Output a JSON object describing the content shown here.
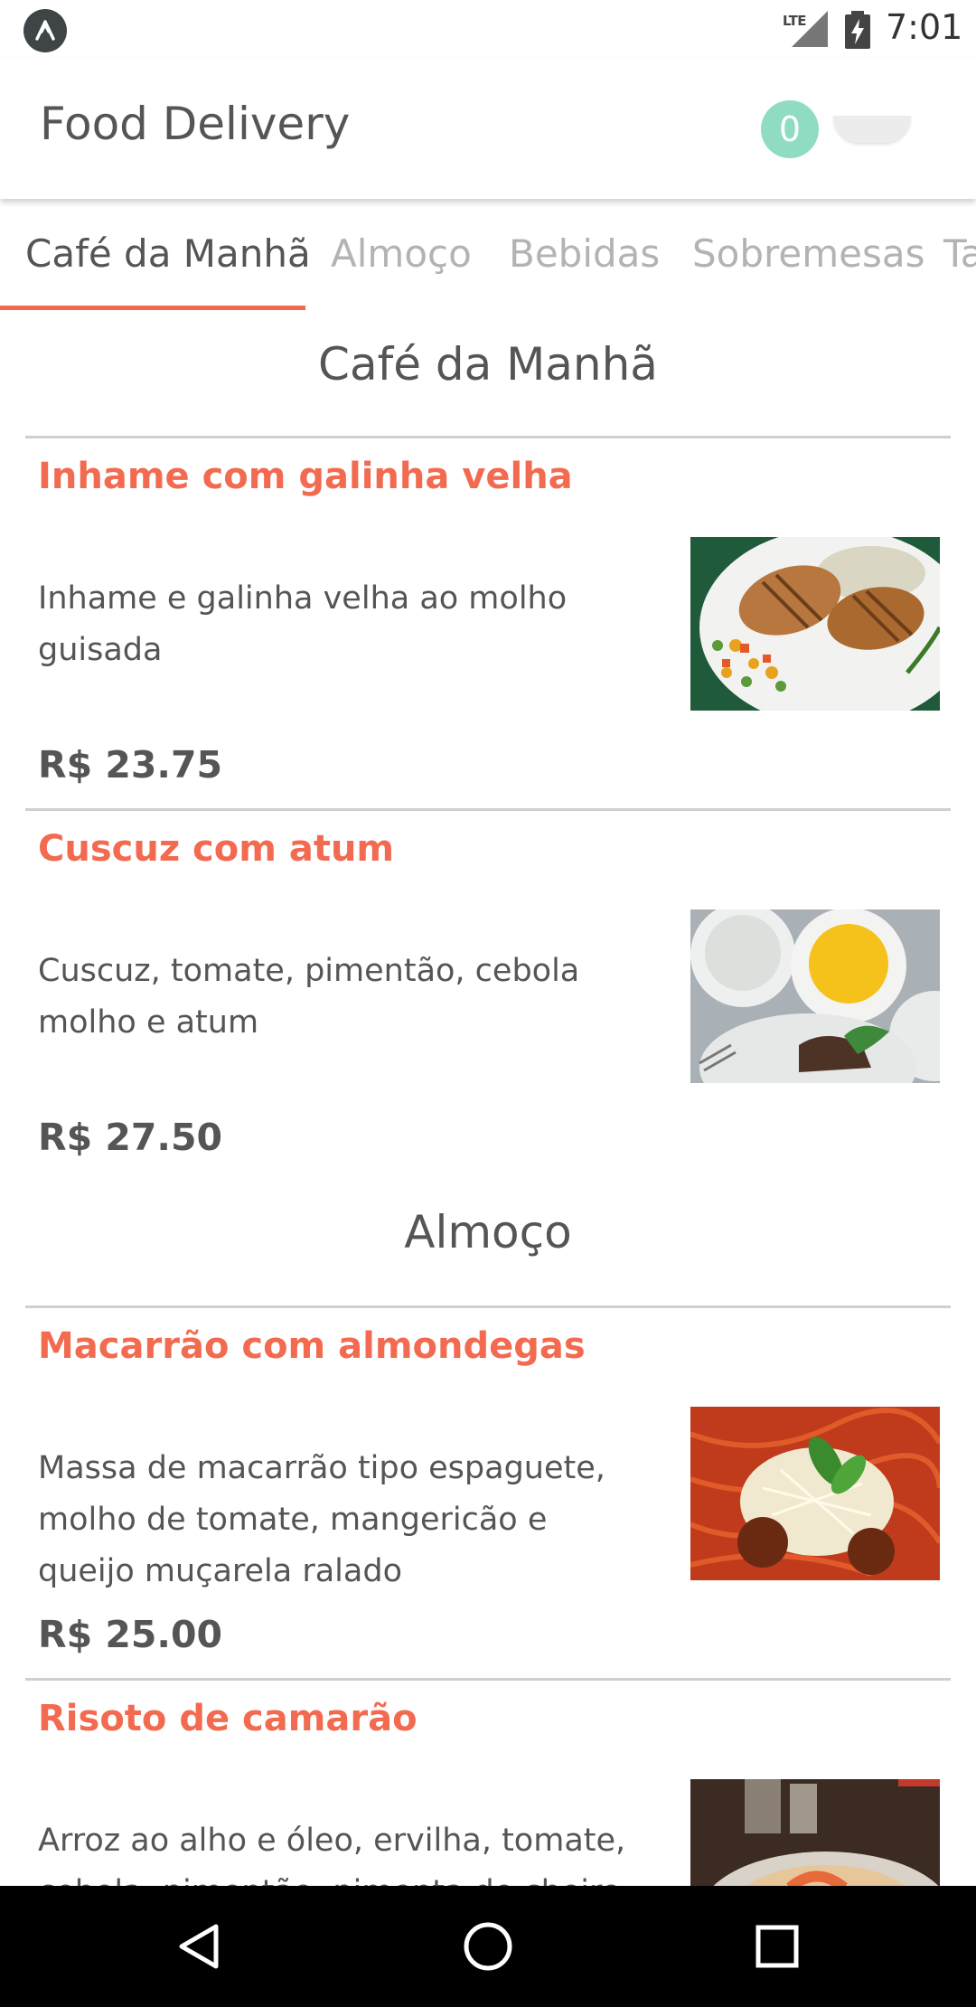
{
  "status_bar": {
    "network": "LTE",
    "time": "7:01",
    "icons": [
      "expo-icon",
      "signal-icon",
      "battery-charging-icon"
    ]
  },
  "app_bar": {
    "title": "Food Delivery",
    "cart_count": "0"
  },
  "tabs": [
    {
      "label": "Café da Manhã",
      "active": true
    },
    {
      "label": "Almoço",
      "active": false
    },
    {
      "label": "Bebidas",
      "active": false
    },
    {
      "label": "Sobremesas",
      "active": false
    },
    {
      "label": "Ta",
      "active": false
    }
  ],
  "sections": [
    {
      "title": "Café da Manhã",
      "items": [
        {
          "name": "Inhame com galinha velha",
          "description": "Inhame e galinha velha ao molho guisada",
          "price": "R$ 23.75",
          "image": "grilled-chicken-plate"
        },
        {
          "name": "Cuscuz com atum",
          "description": "Cuscuz, tomate, pimentão, cebola molho e atum",
          "price": "R$ 27.50",
          "image": "cuscuz-plates"
        }
      ]
    },
    {
      "title": "Almoço",
      "items": [
        {
          "name": "Macarrão com almondegas",
          "description": "Massa de macarrão tipo espaguete, molho de tomate, mangericão e queijo muçarela ralado",
          "price": "R$ 25.00",
          "image": "spaghetti-meatballs"
        },
        {
          "name": "Risoto de camarão",
          "description": "Arroz ao alho e óleo, ervilha, tomate, cebola, pimentão, pimenta de cheiro e",
          "price": "",
          "image": "shrimp-risotto"
        }
      ]
    }
  ],
  "nav_bar": {
    "icons": [
      "back-icon",
      "home-icon",
      "recents-icon"
    ]
  },
  "colors": {
    "accent": "#f26b50",
    "badge": "#8fdcc2",
    "text": "#555555",
    "inactive_tab": "#b3b3b3",
    "divider": "#cfcfcf"
  }
}
